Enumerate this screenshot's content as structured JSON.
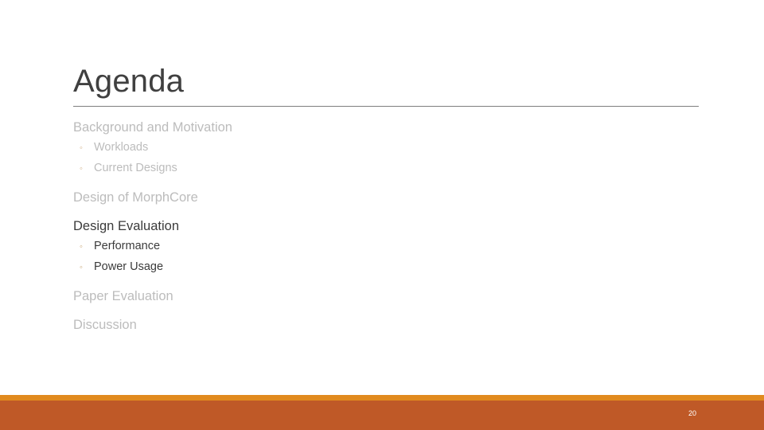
{
  "slide": {
    "title": "Agenda",
    "page_number": "20",
    "theme": {
      "accent_orange": "#e18a1e",
      "footer_brick": "#bf5927",
      "dim_text": "#bcbcbc",
      "active_text": "#3b3b3b",
      "rule_gray": "#7f7f7f",
      "bullet_tan": "#d2b48c"
    }
  },
  "agenda": {
    "bullet_glyph": "◦",
    "groups": [
      {
        "heading": "Background and Motivation",
        "active": false,
        "subitems": [
          {
            "label": "Workloads",
            "active": false
          },
          {
            "label": "Current Designs",
            "active": false
          }
        ]
      },
      {
        "heading": "Design of MorphCore",
        "active": false,
        "subitems": []
      },
      {
        "heading": "Design Evaluation",
        "active": true,
        "subitems": [
          {
            "label": "Performance",
            "active": true
          },
          {
            "label": "Power Usage",
            "active": true
          }
        ]
      },
      {
        "heading": "Paper Evaluation",
        "active": false,
        "subitems": []
      },
      {
        "heading": "Discussion",
        "active": false,
        "subitems": []
      }
    ]
  }
}
